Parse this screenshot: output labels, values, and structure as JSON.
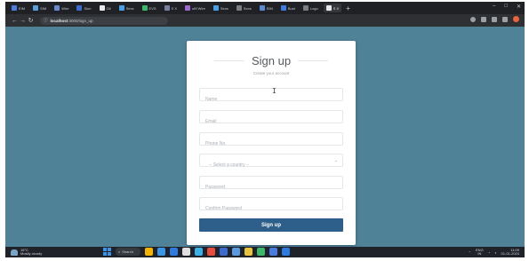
{
  "browser": {
    "tabs": [
      {
        "label": "EIM",
        "color": "#4a7be0"
      },
      {
        "label": "SIM",
        "color": "#5aa0e0"
      },
      {
        "label": "Wire",
        "color": "#6a8ad0"
      },
      {
        "label": "Sion",
        "color": "#3c6bd0"
      },
      {
        "label": "Git",
        "color": "#e6e8eb"
      },
      {
        "label": "Sexs",
        "color": "#4aa0e8"
      },
      {
        "label": "EVS",
        "color": "#3cb86a"
      },
      {
        "label": "S X",
        "color": "#7a7fa0"
      },
      {
        "label": "ufIf Wire",
        "color": "#9a6ad0"
      },
      {
        "label": "Sexs",
        "color": "#4aa0e8"
      },
      {
        "label": "Sexs",
        "color": "#7a7f86"
      },
      {
        "label": "EIM",
        "color": "#5a8ad0"
      },
      {
        "label": "Bust",
        "color": "#3c7ee0"
      },
      {
        "label": "Logo",
        "color": "#7a7f86"
      },
      {
        "label": "S X",
        "color": "#e6e8eb",
        "active": true
      }
    ],
    "new_tab": "+",
    "window_controls": [
      "–",
      "□",
      "✕"
    ],
    "nav": {
      "back": "←",
      "forward": "→",
      "reload": "↻"
    },
    "url": {
      "host": "localhost",
      "path": ":3000/sign_up"
    },
    "toolbar_icons": [
      "share-icon",
      "star-icon",
      "extensions-icon",
      "sidebar-icon",
      "profile-icon"
    ]
  },
  "form": {
    "title": "Sign up",
    "subtitle": "Create your account",
    "fields": {
      "name": "Name",
      "email": "Email",
      "phone": "Phone No.",
      "country": "-- Select a country --",
      "password": "Password",
      "confirm_password": "Confirm Password"
    },
    "submit": "Sign up",
    "accent": "#2e5f8a"
  },
  "taskbar": {
    "weather_temp": "16°C",
    "weather_text": "Mostly cloudy",
    "search": "Search",
    "apps": [
      "#f4b400",
      "#3a95e8",
      "#2d7be0",
      "#e0e0e0",
      "#3ab0e8",
      "#e84c3c",
      "#3c6bd0",
      "#5a9ae0",
      "#e8c33c",
      "#3cb86a",
      "#4a7be0",
      "#2d7be0"
    ],
    "tray_lang": "ENG",
    "tray_region": "IN",
    "clock_time": "11:09",
    "clock_date": "01-01-2024"
  },
  "colors": {
    "page_background": "#4f8197",
    "card": "#ffffff",
    "taskbar": "#1f2329"
  }
}
